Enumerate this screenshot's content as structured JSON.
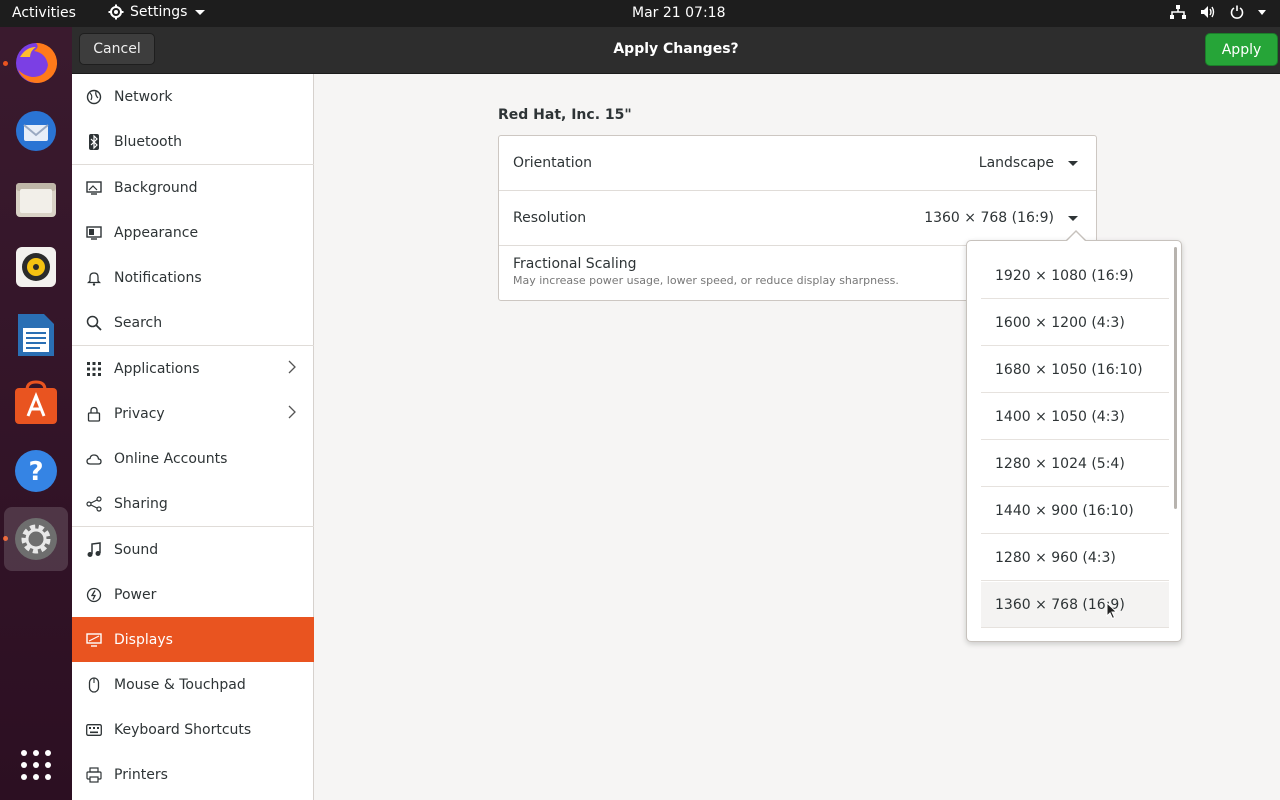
{
  "topbar": {
    "activities": "Activities",
    "app_menu": "Settings",
    "clock": "Mar 21  07:18",
    "tray_icons": [
      "network-icon",
      "volume-icon",
      "power-icon"
    ]
  },
  "dock": {
    "apps": [
      "firefox",
      "thunderbird",
      "files",
      "rhythmbox",
      "libreoffice-writer",
      "ubuntu-software",
      "help",
      "settings"
    ],
    "show_apps": "show-applications-icon"
  },
  "header": {
    "cancel": "Cancel",
    "title": "Apply Changes?",
    "apply": "Apply"
  },
  "sidebar": {
    "items": [
      {
        "label": "Network",
        "icon": "globe-icon"
      },
      {
        "label": "Bluetooth",
        "icon": "bluetooth-icon"
      },
      {
        "label": "Background",
        "icon": "background-icon"
      },
      {
        "label": "Appearance",
        "icon": "appearance-icon"
      },
      {
        "label": "Notifications",
        "icon": "bell-icon"
      },
      {
        "label": "Search",
        "icon": "search-icon"
      },
      {
        "label": "Applications",
        "icon": "grid-icon"
      },
      {
        "label": "Privacy",
        "icon": "lock-icon"
      },
      {
        "label": "Online Accounts",
        "icon": "cloud-icon"
      },
      {
        "label": "Sharing",
        "icon": "share-icon"
      },
      {
        "label": "Sound",
        "icon": "music-note-icon"
      },
      {
        "label": "Power",
        "icon": "power-icon"
      },
      {
        "label": "Displays",
        "icon": "display-icon"
      },
      {
        "label": "Mouse & Touchpad",
        "icon": "mouse-icon"
      },
      {
        "label": "Keyboard Shortcuts",
        "icon": "keyboard-icon"
      },
      {
        "label": "Printers",
        "icon": "printer-icon"
      }
    ],
    "selected": "Displays"
  },
  "display": {
    "monitor_name": "Red Hat, Inc. 15\"",
    "orientation_label": "Orientation",
    "orientation_value": "Landscape",
    "resolution_label": "Resolution",
    "resolution_value": "1360 × 768 (16:9)",
    "fractional_label": "Fractional Scaling",
    "fractional_sub": "May increase power usage, lower speed, or reduce display sharpness."
  },
  "resolution_options": [
    "1920 × 1080 (16:9)",
    "1600 × 1200 (4:3)",
    "1680 × 1050 (16:10)",
    "1400 × 1050 (4:3)",
    "1280 × 1024 (5:4)",
    "1440 × 900 (16:10)",
    "1280 × 960 (4:3)",
    "1360 × 768 (16:9)"
  ],
  "colors": {
    "accent": "#e95420",
    "apply_green": "#26a538",
    "topbar": "#1d1d1d",
    "headerbar": "#2d2d2d"
  }
}
